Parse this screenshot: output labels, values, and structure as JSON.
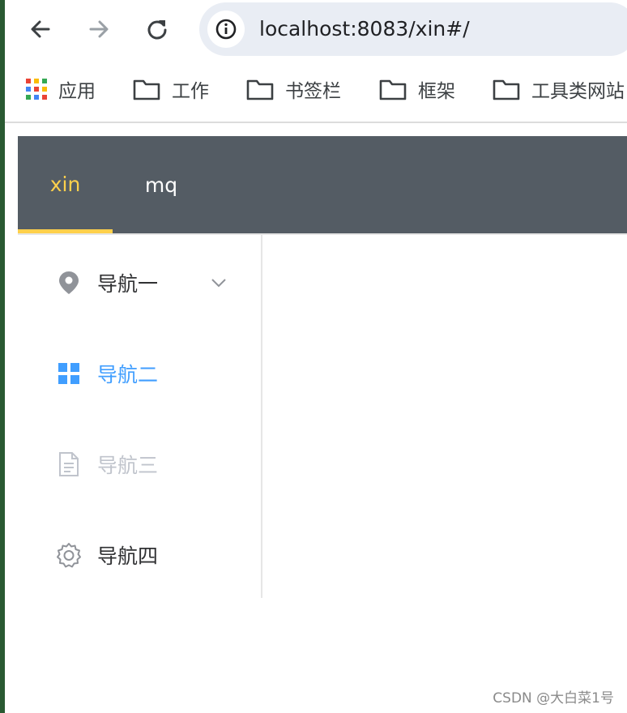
{
  "browser": {
    "url": "localhost:8083/xin#/",
    "bookmarks": [
      {
        "label": "应用",
        "icon": "apps-grid-icon"
      },
      {
        "label": "工作",
        "icon": "folder-icon"
      },
      {
        "label": "书签栏",
        "icon": "folder-icon"
      },
      {
        "label": "框架",
        "icon": "folder-icon"
      },
      {
        "label": "工具类网站",
        "icon": "folder-icon"
      }
    ]
  },
  "header": {
    "tabs": [
      {
        "label": "xin",
        "active": true
      },
      {
        "label": "mq",
        "active": false
      }
    ],
    "background_color": "#545c64",
    "active_color": "#ffd04b"
  },
  "sidebar": {
    "items": [
      {
        "label": "导航一",
        "icon": "location-icon",
        "state": "normal",
        "has_submenu": true
      },
      {
        "label": "导航二",
        "icon": "menu-grid-icon",
        "state": "active"
      },
      {
        "label": "导航三",
        "icon": "document-icon",
        "state": "disabled"
      },
      {
        "label": "导航四",
        "icon": "setting-icon",
        "state": "normal"
      }
    ],
    "active_color": "#409eff",
    "disabled_color": "#c0c4cc",
    "text_color": "#303133"
  },
  "watermark": "CSDN @大白菜1号"
}
